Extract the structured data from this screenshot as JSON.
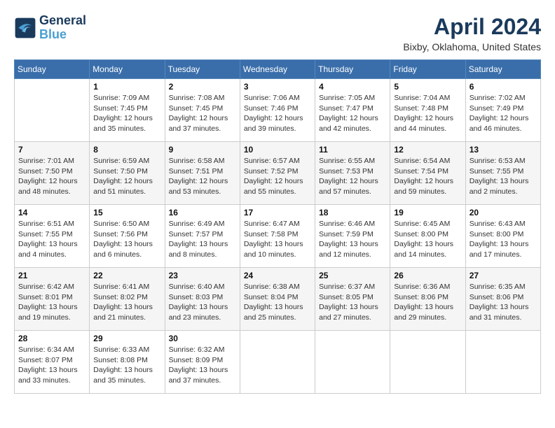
{
  "header": {
    "logo_line1": "General",
    "logo_line2": "Blue",
    "month_year": "April 2024",
    "location": "Bixby, Oklahoma, United States"
  },
  "weekdays": [
    "Sunday",
    "Monday",
    "Tuesday",
    "Wednesday",
    "Thursday",
    "Friday",
    "Saturday"
  ],
  "weeks": [
    [
      {
        "day": "",
        "info": ""
      },
      {
        "day": "1",
        "info": "Sunrise: 7:09 AM\nSunset: 7:45 PM\nDaylight: 12 hours\nand 35 minutes."
      },
      {
        "day": "2",
        "info": "Sunrise: 7:08 AM\nSunset: 7:45 PM\nDaylight: 12 hours\nand 37 minutes."
      },
      {
        "day": "3",
        "info": "Sunrise: 7:06 AM\nSunset: 7:46 PM\nDaylight: 12 hours\nand 39 minutes."
      },
      {
        "day": "4",
        "info": "Sunrise: 7:05 AM\nSunset: 7:47 PM\nDaylight: 12 hours\nand 42 minutes."
      },
      {
        "day": "5",
        "info": "Sunrise: 7:04 AM\nSunset: 7:48 PM\nDaylight: 12 hours\nand 44 minutes."
      },
      {
        "day": "6",
        "info": "Sunrise: 7:02 AM\nSunset: 7:49 PM\nDaylight: 12 hours\nand 46 minutes."
      }
    ],
    [
      {
        "day": "7",
        "info": "Sunrise: 7:01 AM\nSunset: 7:50 PM\nDaylight: 12 hours\nand 48 minutes."
      },
      {
        "day": "8",
        "info": "Sunrise: 6:59 AM\nSunset: 7:50 PM\nDaylight: 12 hours\nand 51 minutes."
      },
      {
        "day": "9",
        "info": "Sunrise: 6:58 AM\nSunset: 7:51 PM\nDaylight: 12 hours\nand 53 minutes."
      },
      {
        "day": "10",
        "info": "Sunrise: 6:57 AM\nSunset: 7:52 PM\nDaylight: 12 hours\nand 55 minutes."
      },
      {
        "day": "11",
        "info": "Sunrise: 6:55 AM\nSunset: 7:53 PM\nDaylight: 12 hours\nand 57 minutes."
      },
      {
        "day": "12",
        "info": "Sunrise: 6:54 AM\nSunset: 7:54 PM\nDaylight: 12 hours\nand 59 minutes."
      },
      {
        "day": "13",
        "info": "Sunrise: 6:53 AM\nSunset: 7:55 PM\nDaylight: 13 hours\nand 2 minutes."
      }
    ],
    [
      {
        "day": "14",
        "info": "Sunrise: 6:51 AM\nSunset: 7:55 PM\nDaylight: 13 hours\nand 4 minutes."
      },
      {
        "day": "15",
        "info": "Sunrise: 6:50 AM\nSunset: 7:56 PM\nDaylight: 13 hours\nand 6 minutes."
      },
      {
        "day": "16",
        "info": "Sunrise: 6:49 AM\nSunset: 7:57 PM\nDaylight: 13 hours\nand 8 minutes."
      },
      {
        "day": "17",
        "info": "Sunrise: 6:47 AM\nSunset: 7:58 PM\nDaylight: 13 hours\nand 10 minutes."
      },
      {
        "day": "18",
        "info": "Sunrise: 6:46 AM\nSunset: 7:59 PM\nDaylight: 13 hours\nand 12 minutes."
      },
      {
        "day": "19",
        "info": "Sunrise: 6:45 AM\nSunset: 8:00 PM\nDaylight: 13 hours\nand 14 minutes."
      },
      {
        "day": "20",
        "info": "Sunrise: 6:43 AM\nSunset: 8:00 PM\nDaylight: 13 hours\nand 17 minutes."
      }
    ],
    [
      {
        "day": "21",
        "info": "Sunrise: 6:42 AM\nSunset: 8:01 PM\nDaylight: 13 hours\nand 19 minutes."
      },
      {
        "day": "22",
        "info": "Sunrise: 6:41 AM\nSunset: 8:02 PM\nDaylight: 13 hours\nand 21 minutes."
      },
      {
        "day": "23",
        "info": "Sunrise: 6:40 AM\nSunset: 8:03 PM\nDaylight: 13 hours\nand 23 minutes."
      },
      {
        "day": "24",
        "info": "Sunrise: 6:38 AM\nSunset: 8:04 PM\nDaylight: 13 hours\nand 25 minutes."
      },
      {
        "day": "25",
        "info": "Sunrise: 6:37 AM\nSunset: 8:05 PM\nDaylight: 13 hours\nand 27 minutes."
      },
      {
        "day": "26",
        "info": "Sunrise: 6:36 AM\nSunset: 8:06 PM\nDaylight: 13 hours\nand 29 minutes."
      },
      {
        "day": "27",
        "info": "Sunrise: 6:35 AM\nSunset: 8:06 PM\nDaylight: 13 hours\nand 31 minutes."
      }
    ],
    [
      {
        "day": "28",
        "info": "Sunrise: 6:34 AM\nSunset: 8:07 PM\nDaylight: 13 hours\nand 33 minutes."
      },
      {
        "day": "29",
        "info": "Sunrise: 6:33 AM\nSunset: 8:08 PM\nDaylight: 13 hours\nand 35 minutes."
      },
      {
        "day": "30",
        "info": "Sunrise: 6:32 AM\nSunset: 8:09 PM\nDaylight: 13 hours\nand 37 minutes."
      },
      {
        "day": "",
        "info": ""
      },
      {
        "day": "",
        "info": ""
      },
      {
        "day": "",
        "info": ""
      },
      {
        "day": "",
        "info": ""
      }
    ]
  ]
}
